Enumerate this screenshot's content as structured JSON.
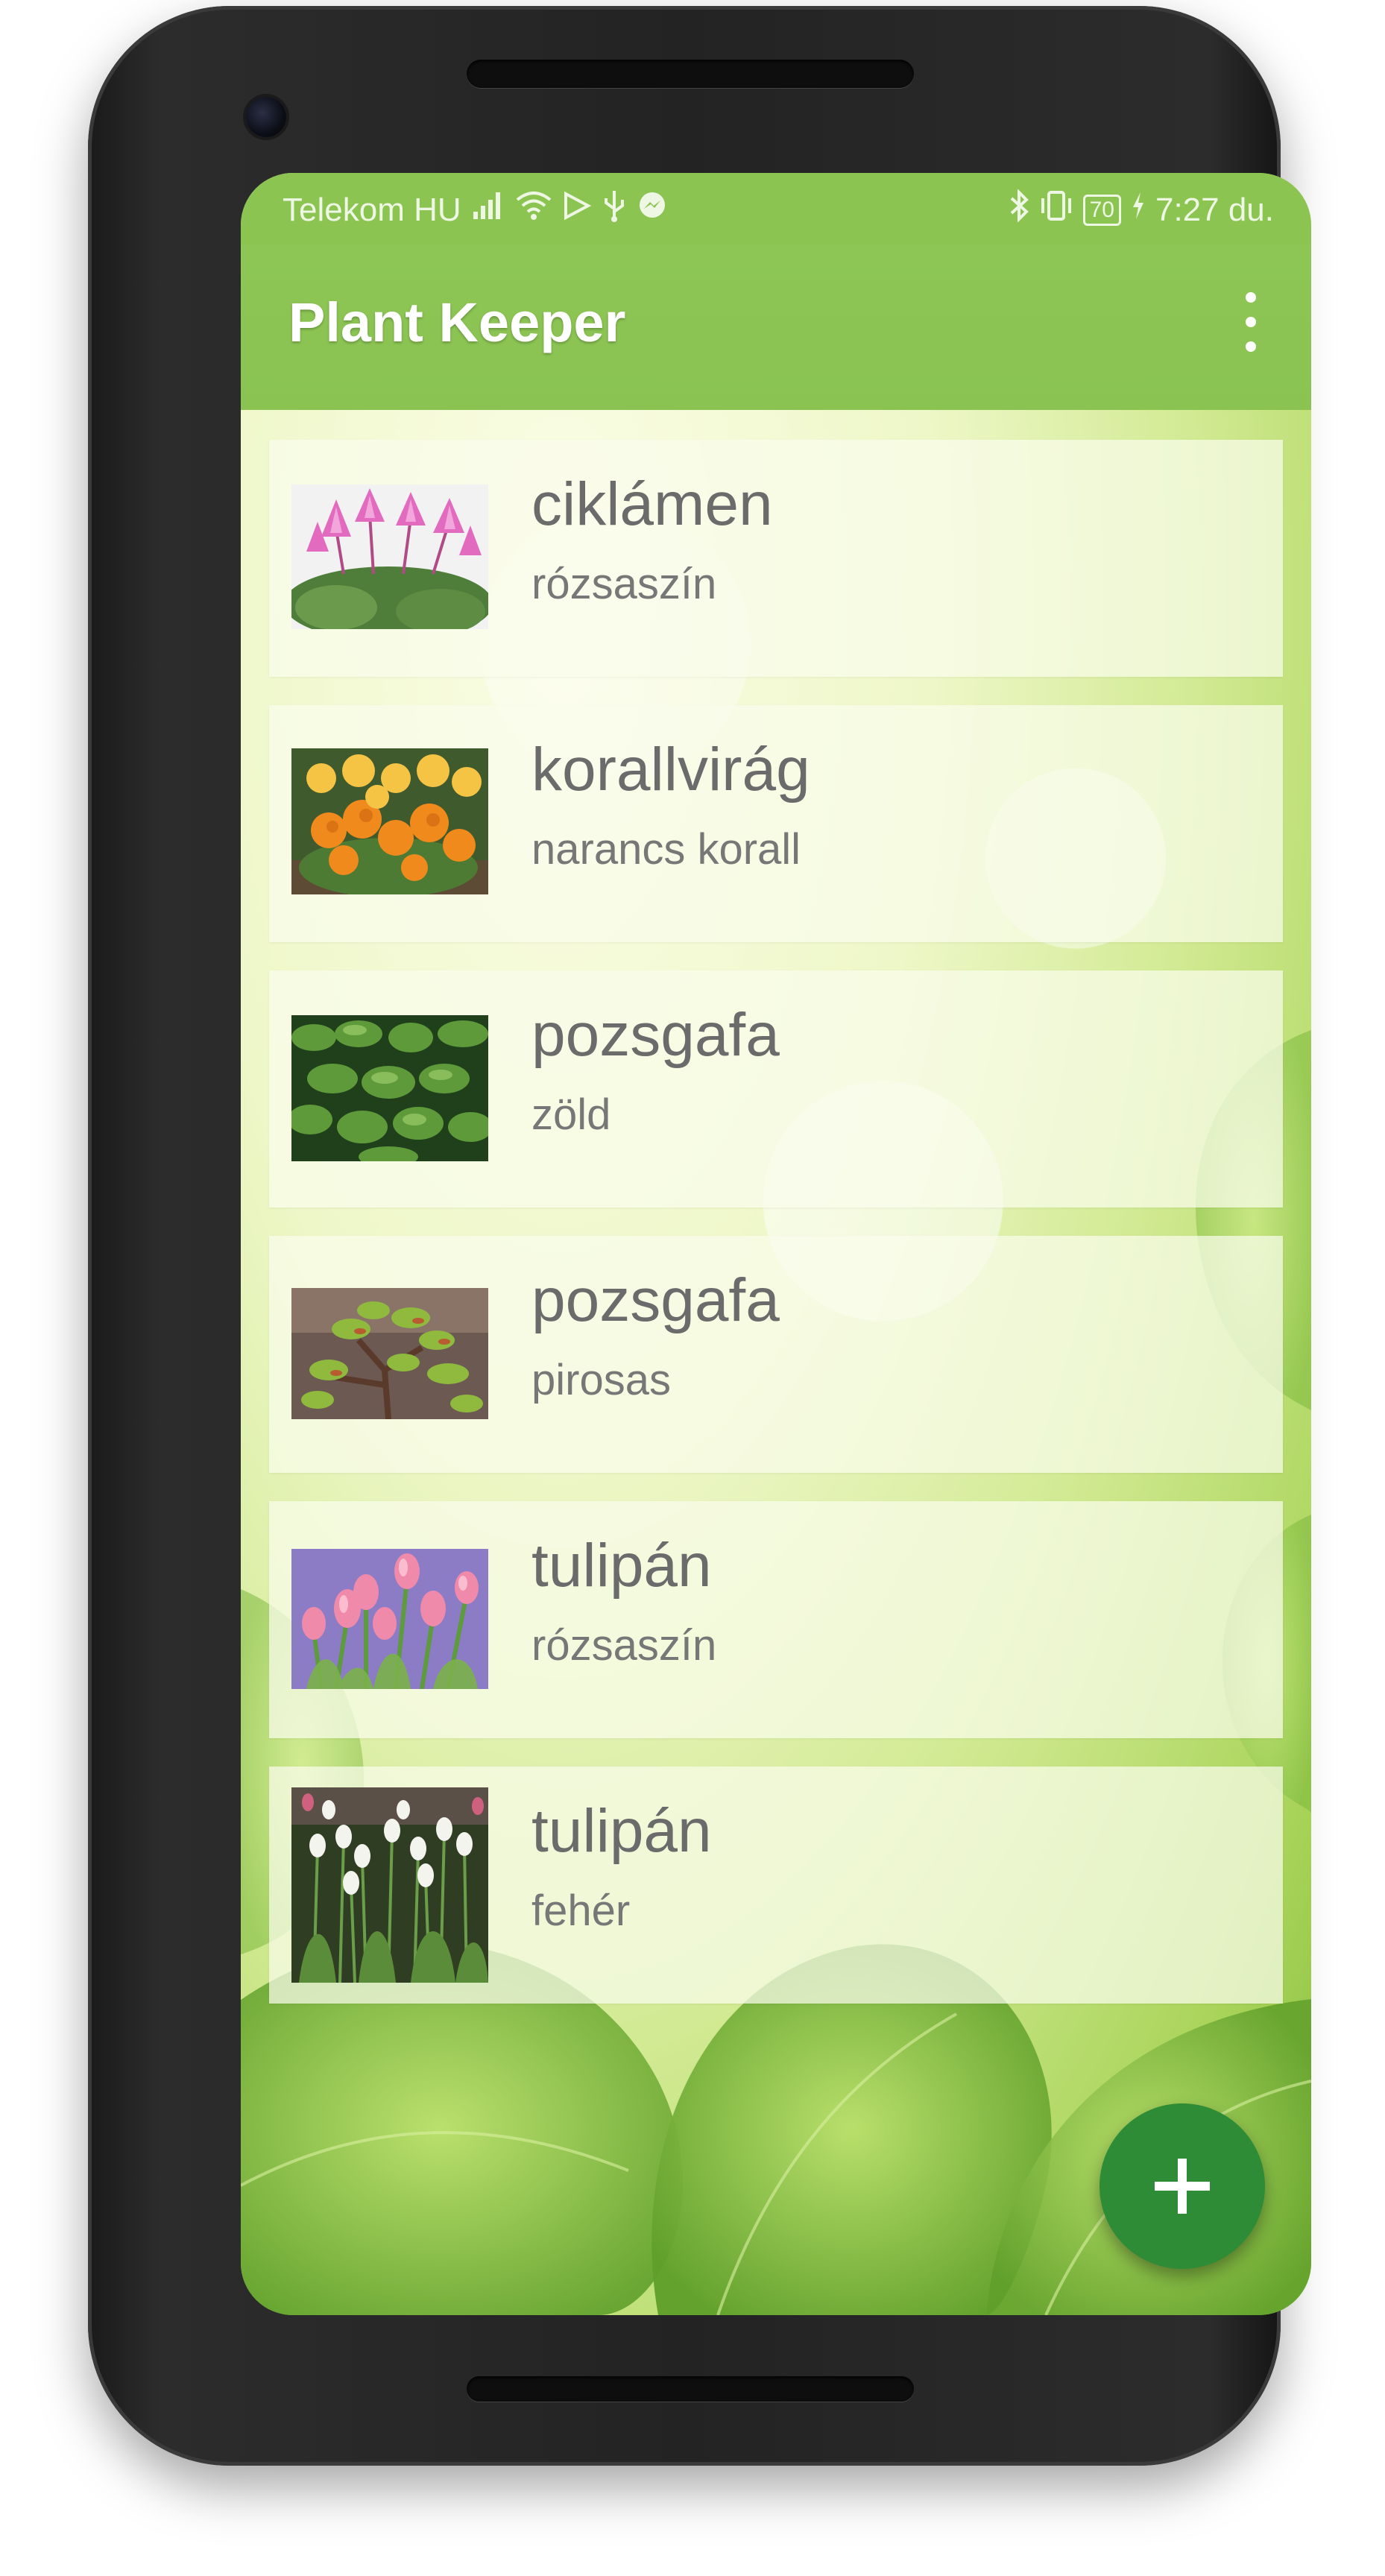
{
  "status_bar": {
    "carrier": "Telekom HU",
    "battery": "70",
    "time": "7:27 du.",
    "icons_left": [
      "signal-icon",
      "wifi-icon",
      "play-store-icon",
      "usb-icon",
      "messenger-icon"
    ],
    "icons_right": [
      "bluetooth-icon",
      "vibrate-icon",
      "battery-icon",
      "charging-icon"
    ]
  },
  "app_bar": {
    "title": "Plant Keeper",
    "menu_icon": "more-vert-icon",
    "accent_color": "#8bc34a"
  },
  "plants": [
    {
      "name": "ciklámen",
      "color": "rózsaszín",
      "image": "pink-cyclamen"
    },
    {
      "name": "korallvirág",
      "color": "narancs korall",
      "image": "orange-kalanchoe"
    },
    {
      "name": "pozsgafa",
      "color": "zöld",
      "image": "green-jade"
    },
    {
      "name": "pozsgafa",
      "color": "pirosas",
      "image": "reddish-jade"
    },
    {
      "name": "tulipán",
      "color": "rózsaszín",
      "image": "pink-tulips"
    },
    {
      "name": "tulipán",
      "color": "fehér",
      "image": "white-tulips"
    }
  ],
  "fab": {
    "icon": "plus-icon",
    "color": "#2e8b36"
  }
}
